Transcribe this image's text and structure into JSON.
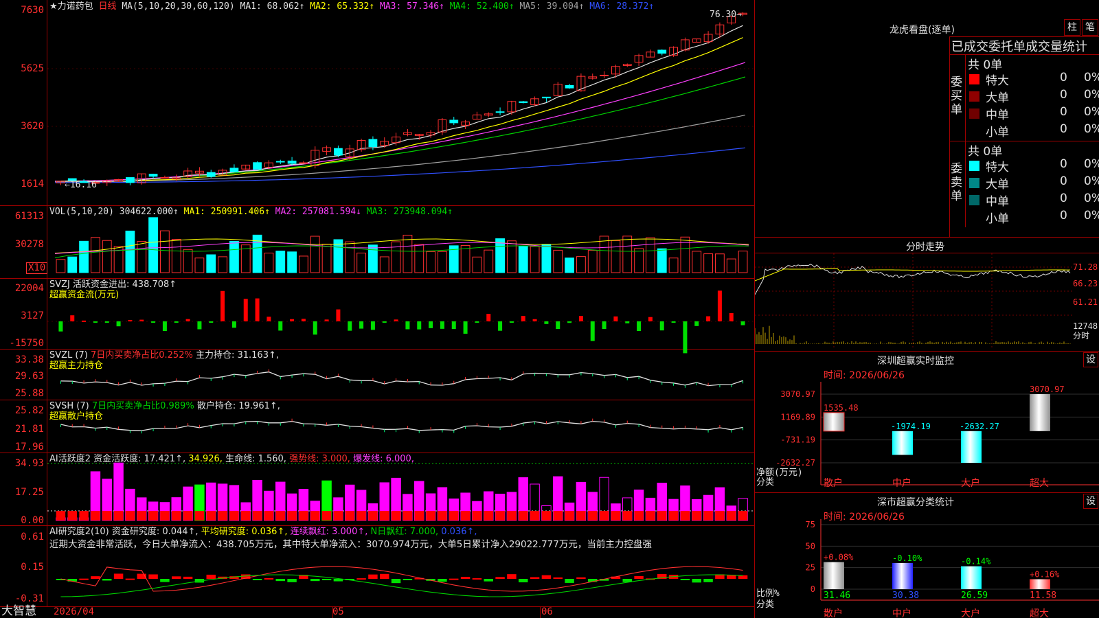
{
  "stock": {
    "name": "★力诺药包",
    "period": "日线",
    "ma_header": "MA(5,10,20,30,60,120)",
    "ma_values": [
      {
        "label": "MA1:",
        "value": "68.062↑",
        "color": "#e0e0e0"
      },
      {
        "label": "MA2:",
        "value": "65.332↑",
        "color": "#ffff00"
      },
      {
        "label": "MA3:",
        "value": "57.346↑",
        "color": "#ff40ff"
      },
      {
        "label": "MA4:",
        "value": "52.400↑",
        "color": "#00d000"
      },
      {
        "label": "MA5:",
        "value": "39.004↑",
        "color": "#a0a0a0"
      },
      {
        "label": "MA6:",
        "value": "28.372↑",
        "color": "#3050ff"
      }
    ],
    "high_mark": "76.30",
    "low_mark": "16.16"
  },
  "axes": {
    "price": [
      "7630",
      "5625",
      "3620",
      "1614"
    ],
    "vol": [
      "61313",
      "30278",
      "X10"
    ],
    "svzj": [
      "22004",
      "3127",
      "-15750"
    ],
    "svzl": [
      "33.38",
      "29.63",
      "25.88"
    ],
    "svsh": [
      "25.82",
      "21.81",
      "17.96"
    ],
    "ai1": [
      "34.93",
      "17.25",
      "0.00"
    ],
    "ai2": [
      "0.61",
      "0.15",
      "-0.31"
    ],
    "dates": [
      "2026/04",
      "05",
      "06"
    ]
  },
  "vol_header": {
    "main": "VOL(5,10,20)",
    "value": "304622.000↑",
    "ma1": "MA1: 250991.406↑",
    "ma2": "MA2: 257081.594↓",
    "ma3": "MA3: 273948.094↑"
  },
  "svzj_header": {
    "main": "SVZJ  活跃资金进出: 438.708↑",
    "sub": "超赢资金流(万元)"
  },
  "svzl_header": {
    "main": "SVZL (7)",
    "red": "7日内买卖净占比0.252%",
    "tail": "主力持仓: 31.163↑,",
    "sub": "超赢主力持仓"
  },
  "svsh_header": {
    "main": "SVSH (7)",
    "green": "7日内买卖净占比0.989%",
    "tail": "散户持仓: 19.961↑,",
    "sub": "超赢散户持仓"
  },
  "ai1_header": {
    "main": "AI活跃度2  资金活跃度: 17.421↑,",
    "v2": "34.926,",
    "v3": "生命线: 1.560,",
    "v4": "强势线: 3.000,",
    "v5": "爆发线: 6.000,"
  },
  "ai2_header": {
    "main": "AI研究度2(10)  资金研究度: 0.044↑,",
    "v2": "平均研究度: 0.036↑,",
    "v3": "连续飘红: 3.000↑,",
    "v4": "N日飘红: 7.000,",
    "v5": "0.036↑,"
  },
  "ai2_note": "近期大资金非常活跃，今日大单净流入：438.705万元，其中特大单净流入：3070.974万元，大单5日累计净入29022.777万元，当前主力控盘强",
  "bottom_logo": "大智慧",
  "right": {
    "lhb_title": "龙虎看盘(逐单)",
    "btn_zhu": "柱",
    "btn_bi": "笔",
    "tabs": "已成交委托单成交量统计",
    "buy_label": "委买单",
    "sell_label": "委卖单",
    "buy_total": "共 0单",
    "sell_total": "共 0单",
    "buy_rows": [
      {
        "name": "特大",
        "count": "0",
        "pct": "0%",
        "color": "#ff0000"
      },
      {
        "name": "大单",
        "count": "0",
        "pct": "0%",
        "color": "#900000"
      },
      {
        "name": "中单",
        "count": "0",
        "pct": "0%",
        "color": "#700000"
      },
      {
        "name": "小单",
        "count": "0",
        "pct": "0%",
        "color": "#000000"
      }
    ],
    "sell_rows": [
      {
        "name": "特大",
        "count": "0",
        "pct": "0%",
        "color": "#00ffff"
      },
      {
        "name": "大单",
        "count": "0",
        "pct": "0%",
        "color": "#008888"
      },
      {
        "name": "中单",
        "count": "0",
        "pct": "0%",
        "color": "#006868"
      },
      {
        "name": "小单",
        "count": "0",
        "pct": "0%",
        "color": "#000000"
      }
    ],
    "intraday_title": "分时走势",
    "intraday_axis": [
      "71.28",
      "66.23",
      "61.21",
      "12748",
      "分时"
    ],
    "monitor_title": "深圳超赢实时监控",
    "monitor_btn": "设",
    "monitor_time": "时间: 2026/06/26",
    "monitor_axis": [
      "3070.97",
      "1169.89",
      "-731.19",
      "-2632.27"
    ],
    "monitor_ylabel": "净额(万元)",
    "monitor_xlabel": "分类",
    "class_title": "深市超赢分类统计",
    "class_btn": "设",
    "class_time": "时间: 2026/06/26",
    "class_axis": [
      "75",
      "50",
      "25",
      "0"
    ],
    "class_ylabel": "比例%",
    "class_xlabel": "分类"
  },
  "chart_data": [
    {
      "type": "bar",
      "title": "深圳超赢实时监控",
      "ylabel": "净额(万元)",
      "xlabel": "分类",
      "categories": [
        "散户",
        "中户",
        "大户",
        "超大"
      ],
      "values": [
        1535.48,
        -1974.19,
        -2632.27,
        3070.97
      ],
      "labels": [
        "1535.48",
        "-1974.19",
        "-2632.27",
        "3070.97"
      ],
      "ylim": [
        -2632.27,
        3070.97
      ]
    },
    {
      "type": "bar",
      "title": "深市超赢分类统计",
      "ylabel": "比例%",
      "xlabel": "分类",
      "categories": [
        "散户",
        "中户",
        "大户",
        "超大"
      ],
      "values": [
        31.46,
        30.38,
        26.59,
        11.58
      ],
      "changes": [
        "+0.08%",
        "-0.10%",
        "-0.14%",
        "+0.16%"
      ],
      "ylim": [
        0,
        75
      ]
    }
  ]
}
